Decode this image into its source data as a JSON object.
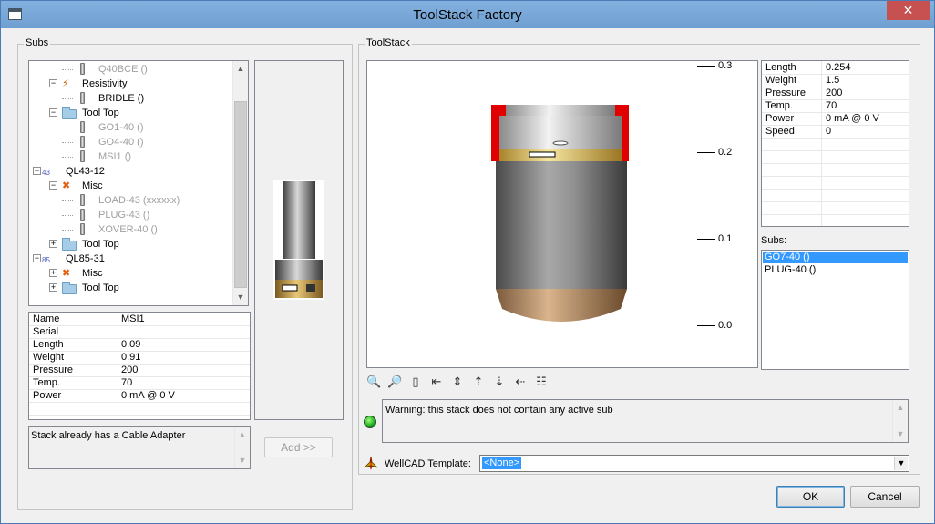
{
  "window": {
    "title": "ToolStack Factory",
    "close": "✕"
  },
  "subs_group": {
    "label": "Subs"
  },
  "tree": [
    {
      "label": "Q40BCE ()",
      "disabled": true
    },
    {
      "label": "Resistivity",
      "disabled": false
    },
    {
      "label": "BRIDLE ()",
      "disabled": false
    },
    {
      "label": "Tool Top",
      "disabled": false
    },
    {
      "label": "GO1-40 ()",
      "disabled": true
    },
    {
      "label": "GO4-40 ()",
      "disabled": true
    },
    {
      "label": "MSI1 ()",
      "disabled": true
    },
    {
      "label": "QL43-12",
      "badge": "43",
      "disabled": false
    },
    {
      "label": "Misc",
      "disabled": false
    },
    {
      "label": "LOAD-43 (xxxxxx)",
      "disabled": true
    },
    {
      "label": "PLUG-43 ()",
      "disabled": true
    },
    {
      "label": "XOVER-40 ()",
      "disabled": true
    },
    {
      "label": "Tool Top",
      "disabled": false
    },
    {
      "label": "QL85-31",
      "badge": "85",
      "disabled": false
    },
    {
      "label": "Misc",
      "disabled": false
    },
    {
      "label": "Tool Top",
      "disabled": false
    }
  ],
  "sub_props": [
    {
      "key": "Name",
      "value": "MSI1"
    },
    {
      "key": "Serial",
      "value": ""
    },
    {
      "key": "Length",
      "value": "0.09"
    },
    {
      "key": "Weight",
      "value": "0.91"
    },
    {
      "key": "Pressure",
      "value": "200"
    },
    {
      "key": "Temp.",
      "value": "70"
    },
    {
      "key": "Power",
      "value": "0 mA @ 0 V"
    }
  ],
  "message": "Stack already has a Cable Adapter",
  "add_button": "Add >>",
  "toolstack_group": {
    "label": "ToolStack"
  },
  "scale_ticks": [
    "0.3",
    "0.2",
    "0.1",
    "0.0"
  ],
  "stack_props": [
    {
      "key": "Length",
      "value": "0.254"
    },
    {
      "key": "Weight",
      "value": "1.5"
    },
    {
      "key": "Pressure",
      "value": "200"
    },
    {
      "key": "Temp.",
      "value": "70"
    },
    {
      "key": "Power",
      "value": "0 mA @ 0 V"
    },
    {
      "key": "Speed",
      "value": "0"
    }
  ],
  "subs_list": {
    "label": "Subs:",
    "items": [
      {
        "label": "GO7-40 ()",
        "selected": true
      },
      {
        "label": "PLUG-40 ()",
        "selected": false
      }
    ]
  },
  "warning": "Warning: this stack does not contain any active sub",
  "template": {
    "label": "WellCAD Template:",
    "value": "<None>"
  },
  "buttons": {
    "ok": "OK",
    "cancel": "Cancel"
  },
  "toolbar_icons": [
    "zoom-out-icon",
    "zoom-in-icon",
    "page-icon",
    "move-first-icon",
    "insert-icon",
    "move-up-icon",
    "move-down-icon",
    "move-left-icon",
    "align-icon"
  ]
}
